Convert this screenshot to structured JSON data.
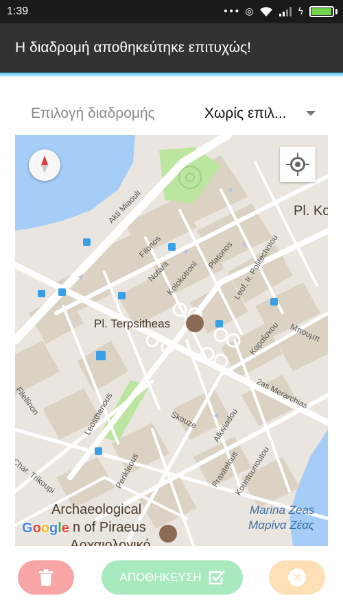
{
  "status_bar": {
    "time": "1:39",
    "icons": [
      "more-dots-icon",
      "hotspot-icon",
      "wifi-icon",
      "signal-icon",
      "charging-icon",
      "battery-icon"
    ],
    "battery_level": 0.95,
    "battery_color": "#6fd34b"
  },
  "snackbar": {
    "message": "Η διαδρομή αποθηκεύτηκε επιτυχώς!"
  },
  "route_selector": {
    "label": "Επιλογή διαδρομής",
    "value": "Χωρίς επιλ..."
  },
  "map": {
    "streets": [
      "Akti Miaouli",
      "Filonos",
      "Notara",
      "Kolokotroni",
      "Platonos",
      "Leof. Ir. Politechniou",
      "Καραΐσκου",
      "Μπουμπ",
      "2as Merarchias",
      "Skouze",
      "Alkiviadou",
      "Praxitelous",
      "Kountourioutou",
      "Leosthenous",
      "Perikleous",
      "Filellinon",
      "Char. Trikoupi"
    ],
    "places": [
      "Pl. Terpsitheas",
      "Pl. Ko",
      "Archaeological",
      "n of Piraeus",
      "Αρχαιολογικό"
    ],
    "water": [
      "Marina Zeas",
      "Μαρίνα Ζέας"
    ],
    "attribution": "Google",
    "colors": {
      "land": "#eae6df",
      "blocks": "#dcd2c3",
      "water": "#a5cdf8",
      "park": "#bce5a0",
      "road": "#ffffff",
      "transit": "#3aa0e5"
    }
  },
  "actions": {
    "save_label": "ΑΠΟΘΗΚΕΥΣΗ",
    "delete_color": "#f8a5a5",
    "save_color": "#a8e9be",
    "cancel_color": "#fde0b6"
  }
}
